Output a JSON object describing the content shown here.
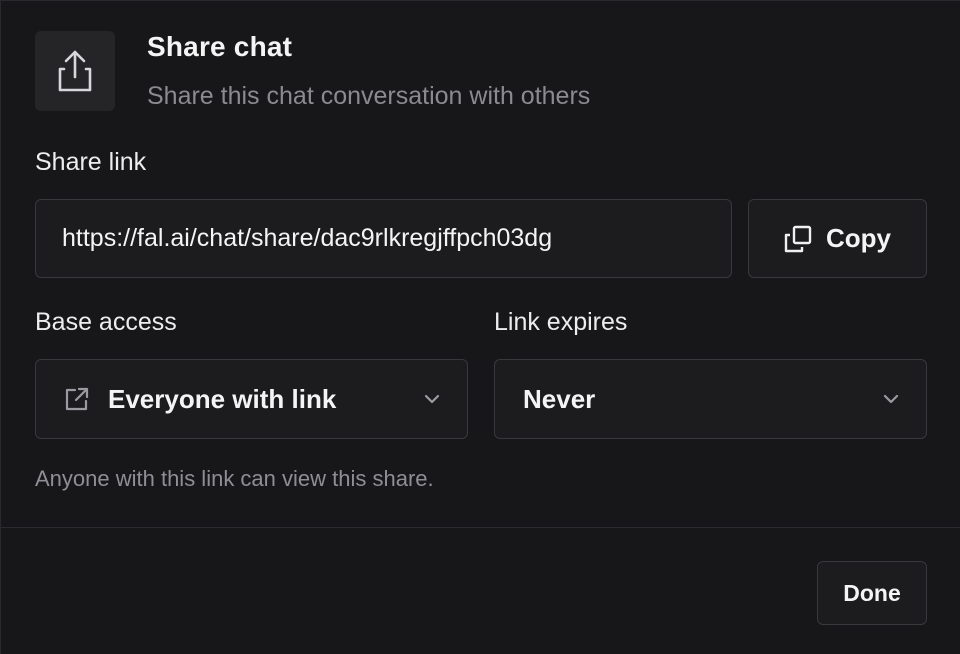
{
  "header": {
    "icon": "share-upload-icon",
    "title": "Share chat",
    "subtitle": "Share this chat conversation with others"
  },
  "share_link": {
    "label": "Share link",
    "value": "https://fal.ai/chat/share/dac9rlkregjffpch03dg",
    "copy_label": "Copy",
    "copy_icon": "copy-icon"
  },
  "base_access": {
    "label": "Base access",
    "selected": "Everyone with link",
    "icon": "external-link-icon"
  },
  "link_expires": {
    "label": "Link expires",
    "selected": "Never"
  },
  "helper_text": "Anyone with this link can view this share.",
  "footer": {
    "done_label": "Done"
  },
  "colors": {
    "background": "#17171a",
    "surface": "#1c1c1f",
    "border": "#38383d",
    "muted_text": "#8a8a90",
    "text": "#f4f4f5"
  }
}
